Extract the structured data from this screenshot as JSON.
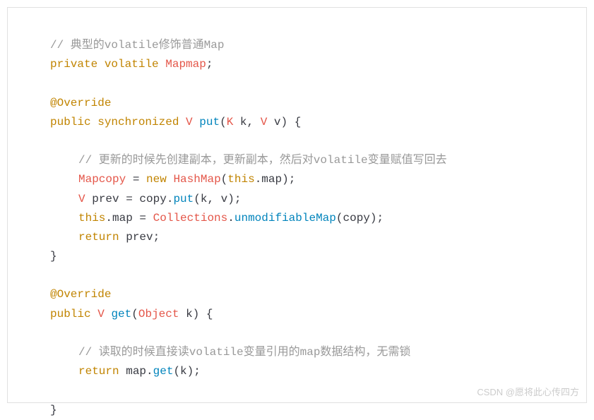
{
  "code": {
    "line1_comment": "// 典型的volatile修饰普通Map",
    "line2_private": "private",
    "line2_volatile": "volatile",
    "line2_mapmap": "Mapmap",
    "line2_semi": ";",
    "line4_override": "@Override",
    "line5_public": "public",
    "line5_synchronized": "synchronized",
    "line5_v": "V",
    "line5_put": "put",
    "line5_paren_open": "(",
    "line5_k_type": "K",
    "line5_k_var": " k, ",
    "line5_v_type": "V",
    "line5_v_var": " v",
    "line5_paren_close": ")",
    "line5_brace": " {",
    "line7_comment": "// 更新的时候先创建副本，更新副本，然后对volatile变量赋值写回去",
    "line8_mapcopy": "Mapcopy",
    "line8_eq": " = ",
    "line8_new": "new",
    "line8_hashmap": "HashMap",
    "line8_paren_open": "(",
    "line8_this": "this",
    "line8_map": ".map",
    "line8_paren_close": ");",
    "line9_v": "V",
    "line9_prev": " prev = copy.",
    "line9_put": "put",
    "line9_args": "(k, v);",
    "line10_this": "this",
    "line10_map": ".map = ",
    "line10_collections": "Collections",
    "line10_dot": ".",
    "line10_unmod": "unmodifiableMap",
    "line10_args": "(copy);",
    "line11_return": "return",
    "line11_prev": " prev;",
    "line12_brace": "}",
    "line14_override": "@Override",
    "line15_public": "public",
    "line15_v": "V",
    "line15_get": "get",
    "line15_paren_open": "(",
    "line15_object": "Object",
    "line15_k": " k",
    "line15_paren_close": ")",
    "line15_brace": " {",
    "line17_comment": "// 读取的时候直接读volatile变量引用的map数据结构，无需锁",
    "line18_return": "return",
    "line18_map": " map.",
    "line18_get": "get",
    "line18_args": "(k);",
    "line19_brace": "}"
  },
  "watermark": "CSDN @愿将此心传四方"
}
